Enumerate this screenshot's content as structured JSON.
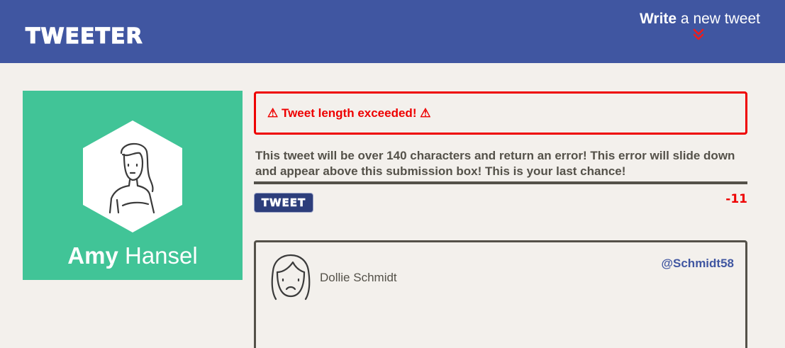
{
  "colors": {
    "nav_bg": "#4056a1",
    "page_bg": "#f3f0ec",
    "profile_bg": "#41c497",
    "error": "#ee0000",
    "text": "#545149",
    "button_bg": "#2d3e7b"
  },
  "nav": {
    "brand": "TWEETER",
    "compose_strong": "Write",
    "compose_rest": " a new tweet",
    "compose_icon": "double-chevron-down-icon"
  },
  "profile": {
    "first_name": "Amy",
    "last_name": "Hansel",
    "avatar_icon": "user-avatar-icon"
  },
  "composer": {
    "error_message": "⚠ Tweet length exceeded! ⚠",
    "text": "This tweet will be over 140 characters and return an error! This error will slide down and appear above this submission box! This is your last chance!",
    "button_label": "TWEET",
    "counter": "-11"
  },
  "tweets": [
    {
      "author": "Dollie Schmidt",
      "handle": "@Schmidt58",
      "avatar_icon": "frowning-avatar-icon"
    }
  ]
}
